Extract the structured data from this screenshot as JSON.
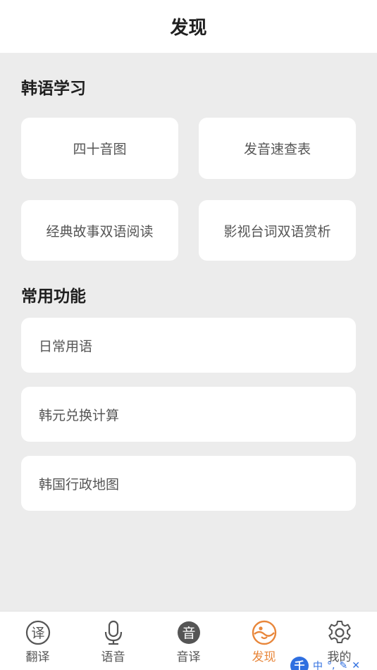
{
  "header": {
    "title": "发现"
  },
  "korean_study": {
    "title": "韩语学习",
    "cards": [
      {
        "label": "四十音图"
      },
      {
        "label": "发音速查表"
      },
      {
        "label": "经典故事双语阅读"
      },
      {
        "label": "影视台词双语赏析"
      }
    ]
  },
  "common_functions": {
    "title": "常用功能",
    "items": [
      {
        "label": "日常用语"
      },
      {
        "label": "韩元兑换计算"
      },
      {
        "label": "韩国行政地图"
      }
    ]
  },
  "tabbar": {
    "active_color": "#e8863a",
    "inactive_color": "#555555",
    "tabs": [
      {
        "label": "翻译",
        "icon": "translate-icon",
        "glyph": "译"
      },
      {
        "label": "语音",
        "icon": "microphone-icon"
      },
      {
        "label": "音译",
        "icon": "transliterate-icon",
        "glyph": "音"
      },
      {
        "label": "发现",
        "icon": "discover-icon",
        "active": true
      },
      {
        "label": "我的",
        "icon": "gear-icon"
      }
    ]
  },
  "ime": {
    "logo": "千",
    "mode": "中"
  }
}
